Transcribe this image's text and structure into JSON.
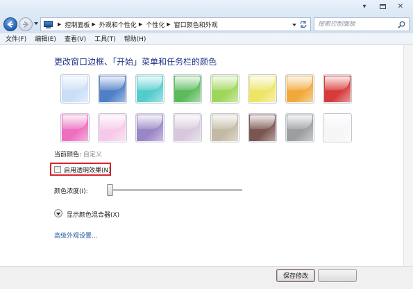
{
  "window": {
    "minimize_glyph": "▾",
    "close_glyph": "✕"
  },
  "address": {
    "crumbs": [
      "控制面板",
      "外观和个性化",
      "个性化",
      "窗口颜色和外观"
    ]
  },
  "search": {
    "placeholder": "搜索控制面板"
  },
  "menu": [
    "文件(F)",
    "编辑(E)",
    "查看(V)",
    "工具(T)",
    "帮助(H)"
  ],
  "page_title": "更改窗口边框、「开始」菜单和任务栏的颜色",
  "swatches": {
    "row1": [
      {
        "name": "sky",
        "color": "#c9def7"
      },
      {
        "name": "twilight",
        "color": "#4f7fc6"
      },
      {
        "name": "sea",
        "color": "#55cccc"
      },
      {
        "name": "leaf",
        "color": "#5cba5c"
      },
      {
        "name": "lime",
        "color": "#9ed65a"
      },
      {
        "name": "lemon",
        "color": "#ede565"
      },
      {
        "name": "pumpkin",
        "color": "#f0a83a"
      },
      {
        "name": "ruby",
        "color": "#d63b3b"
      }
    ],
    "row2": [
      {
        "name": "fuchsia",
        "color": "#ee6fc0"
      },
      {
        "name": "blush",
        "color": "#f6c9e8"
      },
      {
        "name": "violet",
        "color": "#9a86c5"
      },
      {
        "name": "lavender",
        "color": "#d7c8dc"
      },
      {
        "name": "taupe",
        "color": "#c3b9a4"
      },
      {
        "name": "chocolate",
        "color": "#7b5550"
      },
      {
        "name": "slate",
        "color": "#9c9ea1"
      },
      {
        "name": "frost",
        "color": "#f6f6f6"
      }
    ]
  },
  "current_color": {
    "label": "当前颜色:",
    "value": "自定义"
  },
  "transparency": {
    "label": "启用透明效果(N)",
    "checked": false
  },
  "intensity": {
    "label": "颜色浓度(I):",
    "level": 0.0
  },
  "mixer": {
    "label": "显示颜色混合器(X)"
  },
  "advanced_link": "高级外观设置...",
  "buttons": {
    "save": "保存修改"
  },
  "colors": {
    "highlight": "#d9232a",
    "title": "#1e3287",
    "link": "#1e5aa5"
  }
}
